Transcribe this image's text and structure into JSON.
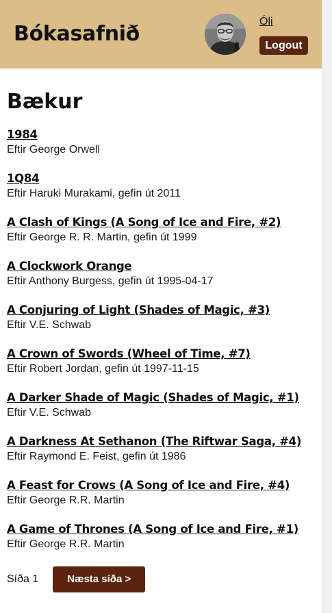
{
  "header": {
    "site_title": "Bókasafnið",
    "user": {
      "name": "Óli",
      "avatar_icon": "user-photo"
    },
    "logout_label": "Logout",
    "background_color": "#dcbd87"
  },
  "main": {
    "title": "Bækur",
    "books": [
      {
        "title": "1984",
        "meta": "Eftir George Orwell"
      },
      {
        "title": "1Q84",
        "meta": "Eftir Haruki Murakami, gefin út 2011"
      },
      {
        "title": "A Clash of Kings (A Song of Ice and Fire, #2)",
        "meta": "Eftir George R. R. Martin, gefin út 1999"
      },
      {
        "title": "A Clockwork Orange",
        "meta": "Eftir Anthony Burgess, gefin út 1995-04-17"
      },
      {
        "title": "A Conjuring of Light (Shades of Magic, #3)",
        "meta": "Eftir V.E. Schwab"
      },
      {
        "title": "A Crown of Swords (Wheel of Time, #7)",
        "meta": "Eftir Robert Jordan, gefin út 1997-11-15"
      },
      {
        "title": "A Darker Shade of Magic (Shades of Magic, #1)",
        "meta": "Eftir V.E. Schwab"
      },
      {
        "title": "A Darkness At Sethanon (The Riftwar Saga, #4)",
        "meta": "Eftir Raymond E. Feist, gefin út 1986"
      },
      {
        "title": "A Feast for Crows (A Song of Ice and Fire, #4)",
        "meta": "Eftir George R.R. Martin"
      },
      {
        "title": "A Game of Thrones (A Song of Ice and Fire, #1)",
        "meta": "Eftir George R.R. Martin"
      }
    ]
  },
  "pagination": {
    "current_page_label": "Síða 1",
    "next_label": "Næsta síða >",
    "button_color": "#5a2411"
  }
}
